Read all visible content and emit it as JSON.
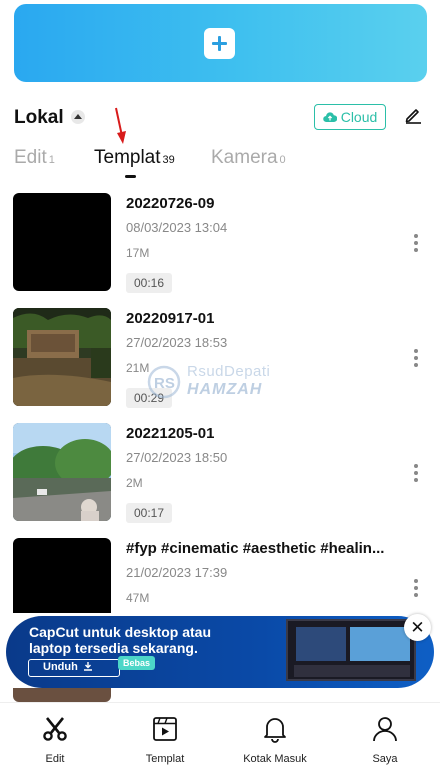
{
  "header": {
    "new_project_icon": "plus-icon"
  },
  "local": {
    "title": "Lokal",
    "cloud_label": "Cloud",
    "cloud_icon": "cloud-upload-icon",
    "edit_icon": "pencil-icon"
  },
  "tabs": [
    {
      "label": "Edit",
      "count": "1"
    },
    {
      "label": "Templat",
      "count": "39"
    },
    {
      "label": "Kamera",
      "count": "0"
    }
  ],
  "items": [
    {
      "title": "20220726-09",
      "date": "08/03/2023 13:04",
      "size": "17M",
      "duration": "00:16"
    },
    {
      "title": "20220917-01",
      "date": "27/02/2023 18:53",
      "size": "21M",
      "duration": "00:29"
    },
    {
      "title": "20221205-01",
      "date": "27/02/2023 18:50",
      "size": "2M",
      "duration": "00:17"
    },
    {
      "title": "#fyp #cinematic #aesthetic #healin...",
      "date": "21/02/2023 17:39",
      "size": "47M",
      "duration": ""
    }
  ],
  "watermark": {
    "top": "RsudDepati",
    "bottom": "HAMZAH",
    "logo": "RS"
  },
  "ad": {
    "line1": "CapCut untuk desktop atau",
    "line2": "laptop tersedia sekarang.",
    "button": "Unduh",
    "badge": "Bebas",
    "close": "✕"
  },
  "tabbar": [
    {
      "label": "Edit",
      "icon": "scissors-icon"
    },
    {
      "label": "Templat",
      "icon": "template-icon"
    },
    {
      "label": "Kotak Masuk",
      "icon": "bell-icon"
    },
    {
      "label": "Saya",
      "icon": "person-icon"
    }
  ],
  "colors": {
    "accent": "#2bbfa8",
    "banner": "#2aa8f0",
    "annotation": "#d81b1b"
  }
}
